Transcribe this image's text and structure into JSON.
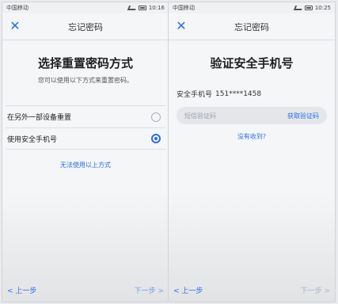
{
  "left_screen": {
    "status": {
      "carrier": "中国移动",
      "time": "10:16"
    },
    "nav": {
      "title": "忘记密码"
    },
    "heading": "选择重置密码方式",
    "subtitle": "您可以使用以下方式来重置密码。",
    "options": [
      {
        "label": "在另外一部设备重置",
        "selected": false
      },
      {
        "label": "使用安全手机号",
        "selected": true
      }
    ],
    "alt_link": "无法使用以上方式",
    "bottom": {
      "back": "< 上一步",
      "next": "下一步 >"
    }
  },
  "right_screen": {
    "status": {
      "carrier": "中国移动",
      "time": "10:25"
    },
    "nav": {
      "title": "忘记密码"
    },
    "heading": "验证安全手机号",
    "phone_label": "安全手机号",
    "phone_number": "151****1458",
    "code_placeholder": "短信验证码",
    "get_code": "获取验证码",
    "not_received": "没有收到?",
    "bottom": {
      "back": "< 上一步",
      "next": "下一步 >"
    }
  },
  "colors": {
    "accent": "#2b6de8",
    "bg": "#f5f6f8"
  }
}
